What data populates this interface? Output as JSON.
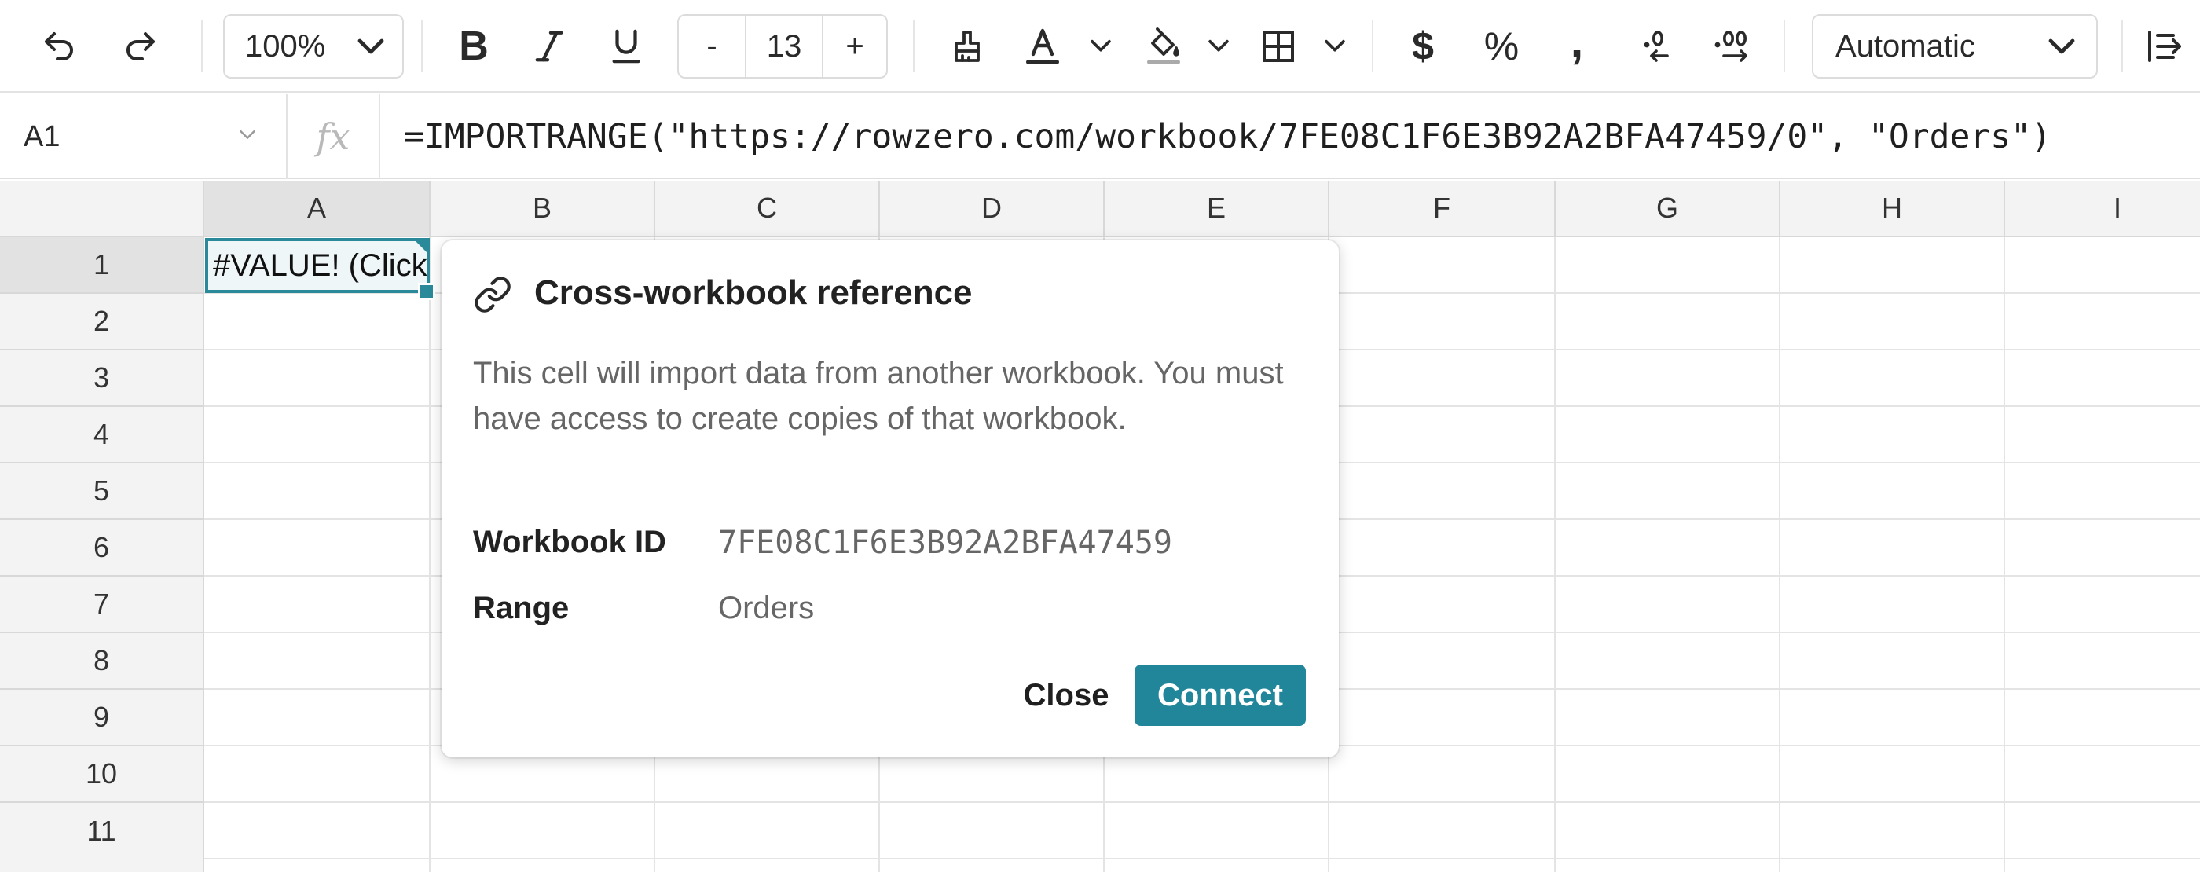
{
  "toolbar": {
    "zoom": "100%",
    "font_size": "13",
    "decrement_label": "-",
    "increment_label": "+",
    "bold_label": "B",
    "italic_label": "I",
    "underline_label": "U",
    "currency_label": "$",
    "percent_label": "%",
    "comma_label": ",",
    "number_format": "Automatic"
  },
  "formula_bar": {
    "cell_ref": "A1",
    "fx_label": "fx",
    "formula": "=IMPORTRANGE(\"https://rowzero.com/workbook/7FE08C1F6E3B92A2BFA47459/0\", \"Orders\")"
  },
  "grid": {
    "columns": [
      "A",
      "B",
      "C",
      "D",
      "E",
      "F",
      "G",
      "H",
      "I"
    ],
    "rows": [
      "1",
      "2",
      "3",
      "4",
      "5",
      "6",
      "7",
      "8",
      "9",
      "10",
      "11"
    ],
    "a1_value": "#VALUE! (Click"
  },
  "popover": {
    "title": "Cross-workbook reference",
    "description": "This cell will import data from another workbook. You must have access to create copies of that workbook.",
    "workbook_id_label": "Workbook ID",
    "workbook_id": "7FE08C1F6E3B92A2BFA47459",
    "range_label": "Range",
    "range": "Orders",
    "close_label": "Close",
    "connect_label": "Connect"
  },
  "colors": {
    "accent": "#21869a",
    "selection_border": "#2a8a9a",
    "header_bg": "#f3f3f3"
  }
}
